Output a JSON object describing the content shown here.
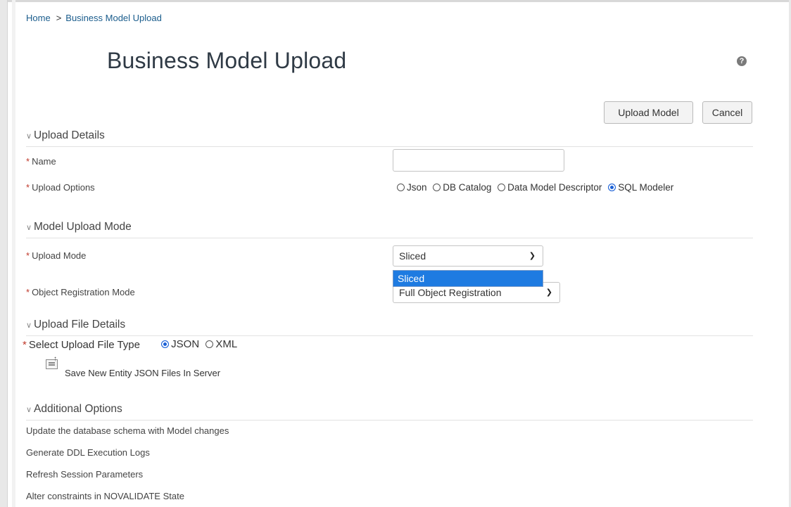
{
  "breadcrumb": {
    "home": "Home",
    "separator": ">",
    "current": "Business Model Upload"
  },
  "page": {
    "title": "Business Model Upload",
    "help_icon": "?"
  },
  "toolbar": {
    "upload_label": "Upload Model",
    "cancel_label": "Cancel"
  },
  "sections": {
    "upload_details": "Upload Details",
    "model_upload_mode": "Model Upload Mode",
    "upload_file_details": "Upload File Details",
    "additional_options": "Additional Options"
  },
  "upload_details": {
    "name_label": "Name",
    "name_value": "",
    "upload_options_label": "Upload Options",
    "upload_options": [
      {
        "label": "Json",
        "selected": false
      },
      {
        "label": "DB Catalog",
        "selected": false
      },
      {
        "label": "Data Model Descriptor",
        "selected": false
      },
      {
        "label": "SQL Modeler",
        "selected": true
      }
    ]
  },
  "model_upload_mode": {
    "upload_mode_label": "Upload Mode",
    "upload_mode_value": "Sliced",
    "upload_mode_options_open": [
      "Sliced"
    ],
    "object_registration_label": "Object Registration Mode",
    "object_registration_value": "Full Object Registration"
  },
  "upload_file_details": {
    "file_type_label": "Select Upload File Type",
    "file_types": [
      {
        "label": "JSON",
        "selected": true
      },
      {
        "label": "XML",
        "selected": false
      }
    ],
    "save_label": "Save New Entity JSON Files In Server"
  },
  "additional_options": [
    "Update the database schema with Model changes",
    "Generate DDL Execution Logs",
    "Refresh Session Parameters",
    "Alter constraints in NOVALIDATE State"
  ],
  "colors": {
    "link": "#1a5c8c",
    "required": "#c0392b",
    "radio_selected": "#1a60d6",
    "dropdown_highlight": "#1e7be1"
  },
  "icons": {
    "help": "help-icon",
    "chevron": "chevron-down-icon",
    "save": "save-to-server-icon",
    "select_caret": "caret-down-icon"
  }
}
